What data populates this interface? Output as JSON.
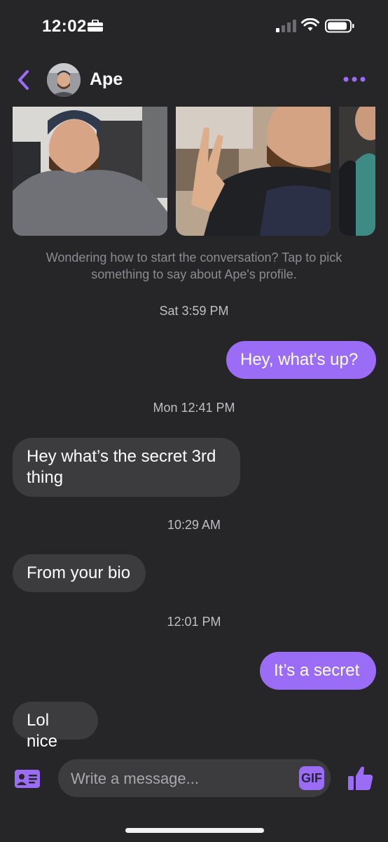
{
  "status_bar": {
    "time": "12:02"
  },
  "header": {
    "name": "Ape"
  },
  "photos": [
    {
      "name": "profile-photo-1"
    },
    {
      "name": "profile-photo-2"
    },
    {
      "name": "profile-photo-3"
    }
  ],
  "hint": "Wondering how to start the conversation? Tap to pick something to say about Ape's profile.",
  "messages": [
    {
      "type": "timestamp",
      "text": "Sat 3:59 PM"
    },
    {
      "type": "outgoing",
      "text": "Hey, what's up?"
    },
    {
      "type": "timestamp",
      "text": "Mon 12:41 PM"
    },
    {
      "type": "incoming",
      "text": "Hey what’s the secret 3rd thing"
    },
    {
      "type": "timestamp",
      "text": "10:29 AM"
    },
    {
      "type": "incoming",
      "text": "From your bio"
    },
    {
      "type": "timestamp",
      "text": "12:01 PM"
    },
    {
      "type": "outgoing",
      "text": "It’s a secret"
    },
    {
      "type": "incoming",
      "text": "Lol nice"
    }
  ],
  "composer": {
    "placeholder": "Write a message...",
    "gif_label": "GIF"
  },
  "colors": {
    "accent": "#9b6cf6",
    "background": "#262628",
    "incoming_bubble": "#3c3c3f"
  }
}
